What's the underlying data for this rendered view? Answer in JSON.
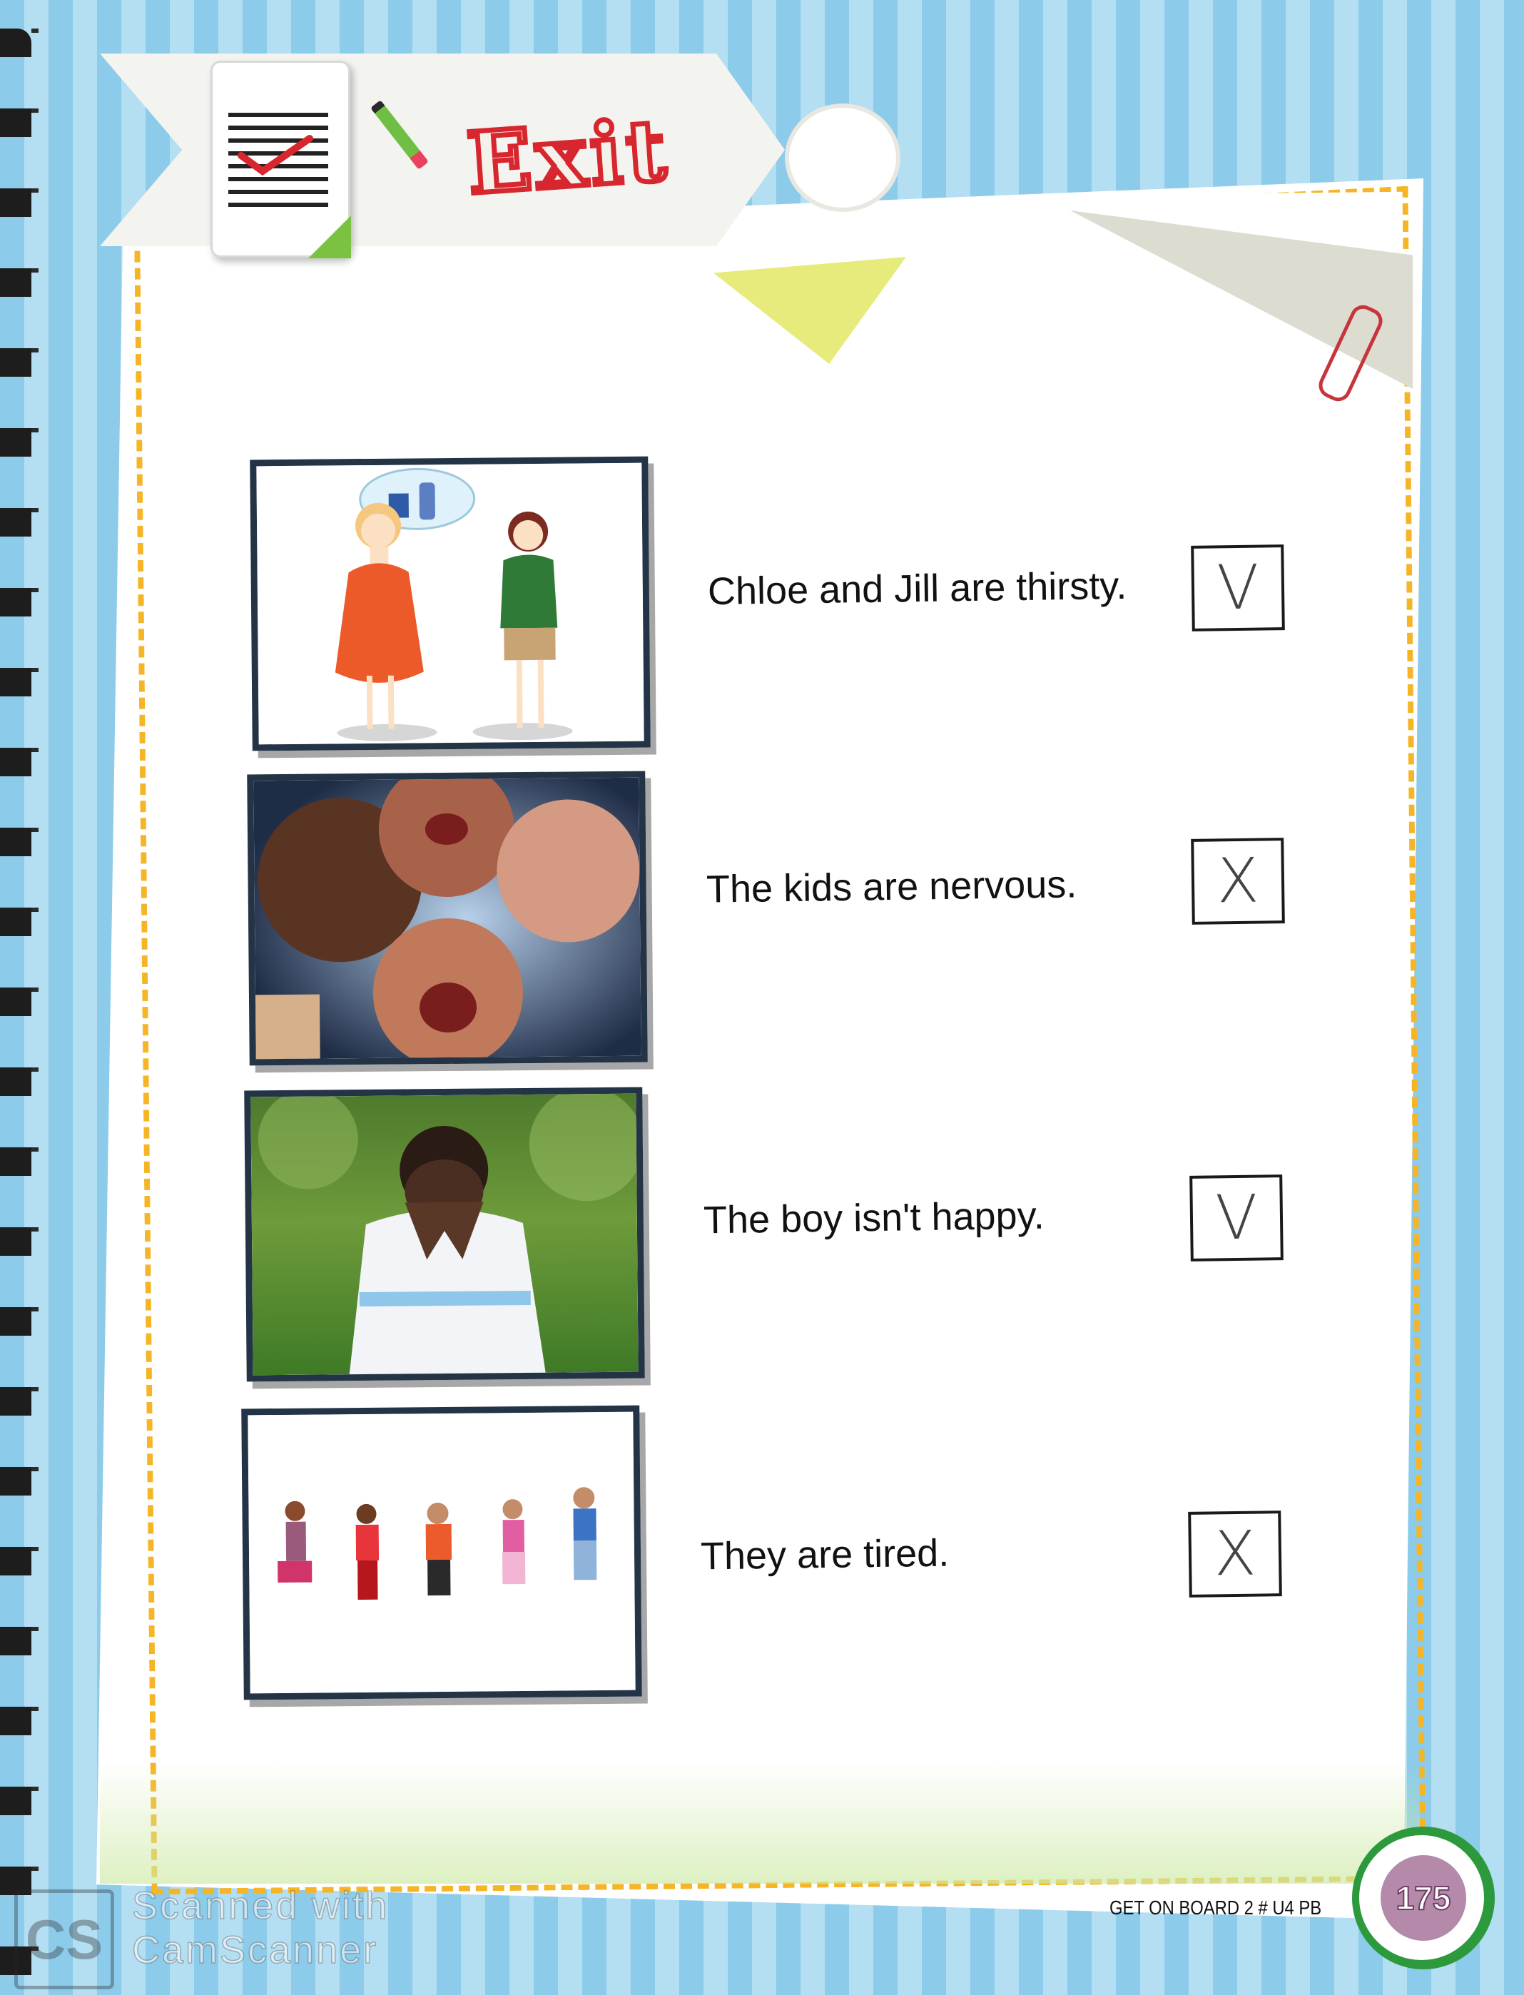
{
  "header": {
    "title": "Exit",
    "icon": "checklist-icon"
  },
  "items": [
    {
      "sentence": "Chloe and Jill are thirsty.",
      "mark": "V",
      "image": "two-girls-thirsty-illustration"
    },
    {
      "sentence": "The kids are nervous.",
      "mark": "X",
      "image": "laughing-kids-photo"
    },
    {
      "sentence": "The boy isn't happy.",
      "mark": "V",
      "image": "sad-boy-photo"
    },
    {
      "sentence": "They are tired.",
      "mark": "X",
      "image": "jumping-kids-photo"
    }
  ],
  "footer": {
    "book": "GET ON BOARD 2 # U4 PB",
    "page_number": "175"
  },
  "watermark": {
    "logo": "CS",
    "line1": "Scanned with",
    "line2": "CamScanner"
  },
  "colors": {
    "accent_red": "#d7262d",
    "border_yellow": "#f5b526",
    "stripe_blue": "#8ccbea",
    "page_green": "#2c9a3c"
  }
}
